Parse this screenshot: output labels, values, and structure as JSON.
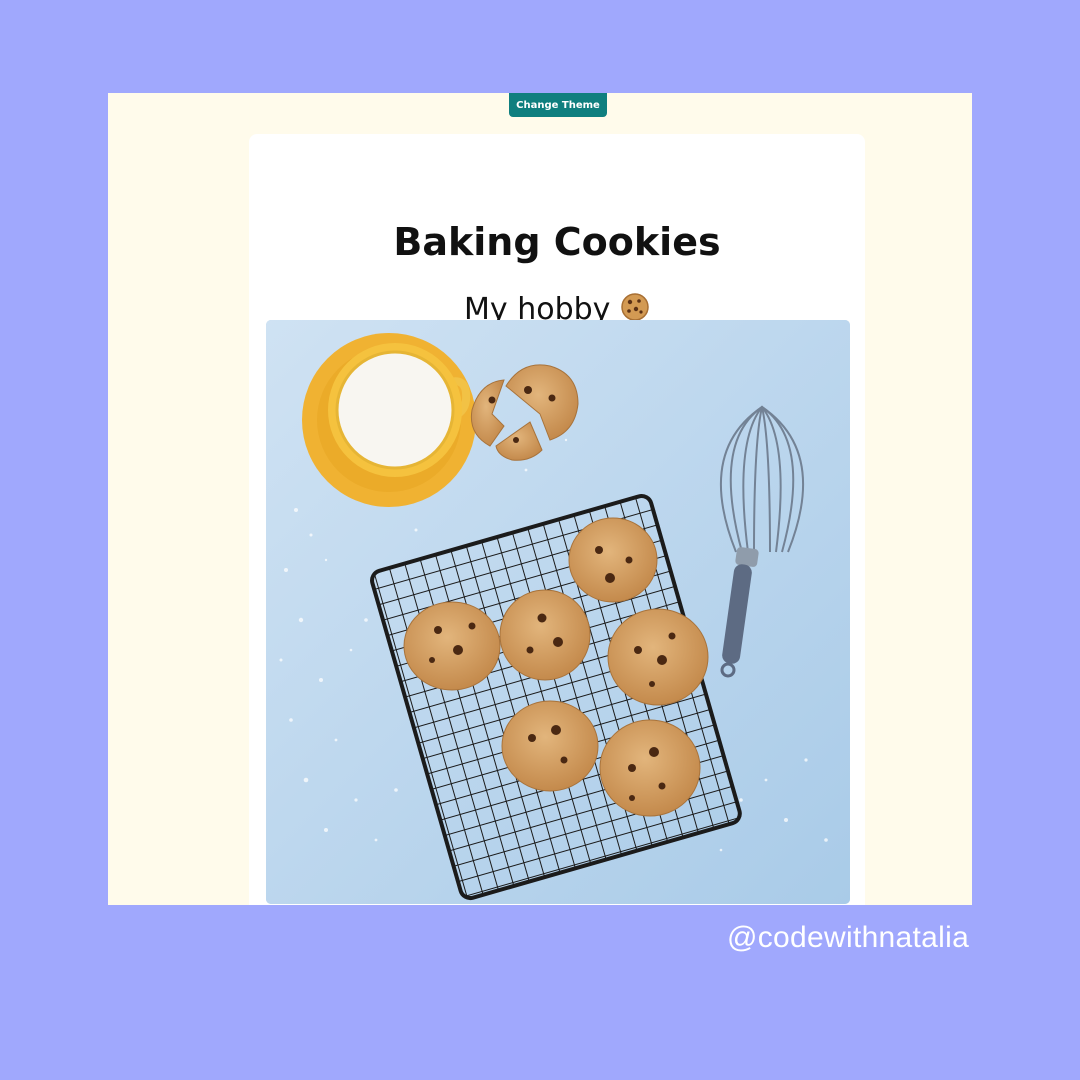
{
  "toolbar": {
    "theme_button_label": "Change Theme"
  },
  "card": {
    "title": "Baking Cookies",
    "subtitle": "My hobby",
    "subtitle_emoji": "🍪",
    "photo_alt": "Chocolate chip cookies on a cooling rack"
  },
  "footer": {
    "handle": "@codewithnatalia"
  },
  "colors": {
    "page_background": "#a0a8fd",
    "viewport_background": "#fffbeb",
    "button": "#0f7f7f",
    "card": "#ffffff"
  }
}
